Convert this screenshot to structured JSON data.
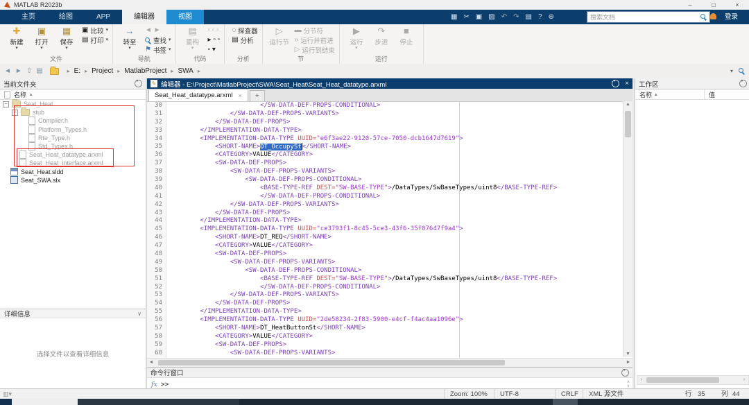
{
  "colors": {
    "accent_dark_blue": "#0b3e6d",
    "view_tab_blue": "#1e8bd0",
    "selection_blue": "#316ac5",
    "xml_tag": "#7a3db8",
    "xml_attr": "#c0504d",
    "xml_string": "#a031d0",
    "annotation_red": "#e03131"
  },
  "window": {
    "title": "MATLAB R2023b",
    "controls": {
      "minimize": "–",
      "maximize": "□",
      "close": "×"
    }
  },
  "ribbon_tabs": [
    {
      "label": "主页",
      "state": "normal"
    },
    {
      "label": "绘图",
      "state": "normal"
    },
    {
      "label": "APP",
      "state": "normal"
    },
    {
      "label": "编辑器",
      "state": "selected"
    },
    {
      "label": "视图",
      "state": "highlighted"
    }
  ],
  "quick_access": {
    "icons": [
      "save-icon",
      "cut-icon",
      "copy-icon",
      "paste-icon",
      "undo-icon",
      "redo-icon",
      "print-icon",
      "help-icon",
      "community-icon"
    ],
    "disabled_icons": [
      "undo-icon",
      "redo-icon"
    ],
    "search_placeholder": "搜索文档",
    "signin_label": "登录"
  },
  "ribbon_groups": [
    {
      "label": "文件",
      "bigs": [
        {
          "label": "新建",
          "icon": "new-icon",
          "dropdown": true
        },
        {
          "label": "打开",
          "icon": "open-icon",
          "dropdown": true
        },
        {
          "label": "保存",
          "icon": "save-file-icon",
          "dropdown": true
        }
      ],
      "smalls": [
        {
          "label": "比较",
          "icon": "compare-icon",
          "dropdown": true
        },
        {
          "label": "打印",
          "icon": "print-doc-icon",
          "dropdown": true
        }
      ]
    },
    {
      "label": "导航",
      "bigs": [
        {
          "label": "转至",
          "icon": "goto-icon",
          "dropdown": true
        }
      ],
      "smalls": [
        {
          "label": "",
          "icon": "nav-arrows-icon",
          "disabled": true
        },
        {
          "label": "查找",
          "icon": "find-icon",
          "dropdown": true
        },
        {
          "label": "书签",
          "icon": "bookmark-icon",
          "dropdown": true
        }
      ]
    },
    {
      "label": "代码",
      "bigs": [
        {
          "label": "重构",
          "icon": "refactor-icon",
          "dropdown": true,
          "disabled": true
        }
      ],
      "smalls": [
        {
          "label": "",
          "icon": "code-tools-a-icon",
          "disabled": true
        },
        {
          "label": "",
          "icon": "code-tools-b-icon"
        },
        {
          "label": "",
          "icon": "code-tools-c-icon"
        }
      ]
    },
    {
      "label": "分析",
      "bigs": [],
      "smalls": [
        {
          "label": "探查器",
          "icon": "profiler-icon"
        },
        {
          "label": "分析",
          "icon": "analyze-icon"
        }
      ]
    },
    {
      "label": "节",
      "bigs": [
        {
          "label": "运行节",
          "icon": "run-section-icon",
          "disabled": true
        }
      ],
      "smalls": [
        {
          "label": "分节符",
          "icon": "section-break-icon",
          "disabled": true
        },
        {
          "label": "运行并前进",
          "icon": "run-advance-icon",
          "disabled": true
        },
        {
          "label": "运行到结束",
          "icon": "run-to-end-icon",
          "disabled": true
        }
      ]
    },
    {
      "label": "运行",
      "bigs": [
        {
          "label": "运行",
          "icon": "run-icon",
          "dropdown": true,
          "disabled": true
        },
        {
          "label": "步进",
          "icon": "step-icon",
          "disabled": true
        },
        {
          "label": "停止",
          "icon": "stop-icon",
          "disabled": true
        }
      ],
      "smalls": []
    }
  ],
  "address_bar": {
    "nav_icons": [
      "back-icon",
      "forward-icon",
      "up-folder-icon",
      "browse-folder-icon"
    ],
    "path_segments": [
      "E:",
      "Project",
      "MatlabProject",
      "SWA"
    ]
  },
  "current_folder": {
    "title": "当前文件夹",
    "column_header": "名称",
    "items": [
      {
        "label": "Seat_Heat",
        "level": 0,
        "icon": "folder",
        "expander": true,
        "gray": true
      },
      {
        "label": "stub",
        "level": 1,
        "icon": "folder",
        "expander": true,
        "gray": true
      },
      {
        "label": "Compiler.h",
        "level": 2,
        "icon": "hfile",
        "expander": false,
        "gray": true
      },
      {
        "label": "Platform_Types.h",
        "level": 2,
        "icon": "hfile",
        "expander": false,
        "gray": true
      },
      {
        "label": "Rte_Type.h",
        "level": 2,
        "icon": "hfile",
        "expander": false,
        "gray": true
      },
      {
        "label": "Std_Types.h",
        "level": 2,
        "icon": "hfile",
        "expander": false,
        "gray": true
      },
      {
        "label": "Seat_Heat_datatype.arxml",
        "level": 1,
        "icon": "xmlfile",
        "expander": false,
        "gray": true
      },
      {
        "label": "Seat_Heat_interface.arxml",
        "level": 1,
        "icon": "xmlfile",
        "expander": false,
        "gray": true
      },
      {
        "label": "Seat_Heat.sldd",
        "level": 0,
        "icon": "sldd",
        "expander": false,
        "gray": false
      },
      {
        "label": "Seat_SWA.slx",
        "level": 0,
        "icon": "slx",
        "expander": false,
        "gray": false
      }
    ]
  },
  "details": {
    "title": "详细信息",
    "empty_text": "选择文件以查看详细信息"
  },
  "editor": {
    "title": "编辑器 - E:\\Project\\MatlabProject\\SWA\\Seat_Heat\\Seat_Heat_datatype.arxml",
    "tab_label": "Seat_Heat_datatype.arxml",
    "first_line_number": 30,
    "selection": {
      "line_number": 35,
      "token": "DT_OccupySt"
    },
    "lines": [
      "                        </SW-DATA-DEF-PROPS-CONDITIONAL>",
      "                </SW-DATA-DEF-PROPS-VARIANTS>",
      "            </SW-DATA-DEF-PROPS>",
      "        </IMPLEMENTATION-DATA-TYPE>",
      "        <IMPLEMENTATION-DATA-TYPE UUID=\"e6f3ae22-9120-57ce-7050-dcb1647d7619\">",
      "            <SHORT-NAME>DT_OccupySt</SHORT-NAME>",
      "            <CATEGORY>VALUE</CATEGORY>",
      "            <SW-DATA-DEF-PROPS>",
      "                <SW-DATA-DEF-PROPS-VARIANTS>",
      "                    <SW-DATA-DEF-PROPS-CONDITIONAL>",
      "                        <BASE-TYPE-REF DEST=\"SW-BASE-TYPE\">/DataTypes/SwBaseTypes/uint8</BASE-TYPE-REF>",
      "                        </SW-DATA-DEF-PROPS-CONDITIONAL>",
      "                </SW-DATA-DEF-PROPS-VARIANTS>",
      "            </SW-DATA-DEF-PROPS>",
      "        </IMPLEMENTATION-DATA-TYPE>",
      "        <IMPLEMENTATION-DATA-TYPE UUID=\"ce3793f1-8c45-5ce3-43f6-35f07647f9a4\">",
      "            <SHORT-NAME>DT_REQ</SHORT-NAME>",
      "            <CATEGORY>VALUE</CATEGORY>",
      "            <SW-DATA-DEF-PROPS>",
      "                <SW-DATA-DEF-PROPS-VARIANTS>",
      "                    <SW-DATA-DEF-PROPS-CONDITIONAL>",
      "                        <BASE-TYPE-REF DEST=\"SW-BASE-TYPE\">/DataTypes/SwBaseTypes/uint8</BASE-TYPE-REF>",
      "                        </SW-DATA-DEF-PROPS-CONDITIONAL>",
      "                </SW-DATA-DEF-PROPS-VARIANTS>",
      "            </SW-DATA-DEF-PROPS>",
      "        </IMPLEMENTATION-DATA-TYPE>",
      "        <IMPLEMENTATION-DATA-TYPE UUID=\"2de58234-2f83-5900-e4cf-f4ac4aa1096e\">",
      "            <SHORT-NAME>DT_HeatButtonSt</SHORT-NAME>",
      "            <CATEGORY>VALUE</CATEGORY>",
      "            <SW-DATA-DEF-PROPS>",
      "                <SW-DATA-DEF-PROPS-VARIANTS>"
    ]
  },
  "command_window": {
    "title": "命令行窗口",
    "prompt_fx": "fx",
    "prompt": ">>"
  },
  "workspace": {
    "title": "工作区",
    "col_name": "名称",
    "col_value": "值"
  },
  "status_bar": {
    "zoom": "Zoom: 100%",
    "encoding": "UTF-8",
    "line_ending": "CRLF",
    "file_type": "XML 源文件",
    "line_label": "行",
    "line": "35",
    "column_label": "列",
    "column": "44"
  }
}
